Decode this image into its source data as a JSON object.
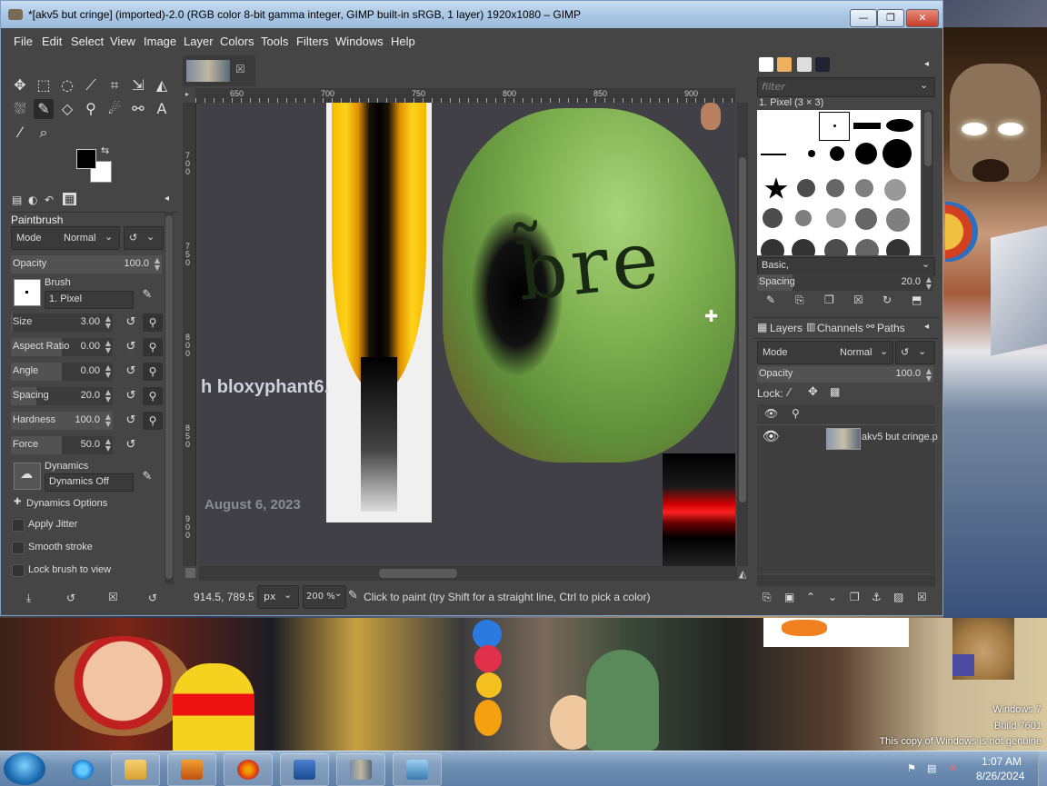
{
  "window": {
    "title": "*[akv5 but cringe] (imported)-2.0 (RGB color 8-bit gamma integer, GIMP built-in sRGB, 1 layer) 1920x1080 – GIMP",
    "min": "—",
    "max": "❐",
    "close": "✕"
  },
  "menu": [
    "File",
    "Edit",
    "Select",
    "View",
    "Image",
    "Layer",
    "Colors",
    "Tools",
    "Filters",
    "Windows",
    "Help"
  ],
  "tool_options": {
    "title": "Paintbrush",
    "mode_label": "Mode",
    "mode_value": "Normal",
    "opacity": {
      "label": "Opacity",
      "value": "100.0",
      "fraction": 1.0
    },
    "brush_label": "Brush",
    "brush_value": "1. Pixel",
    "size": {
      "label": "Size",
      "value": "3.00",
      "fraction": 0.02
    },
    "aspect": {
      "label": "Aspect Ratio",
      "value": "0.00",
      "fraction": 0.5
    },
    "angle": {
      "label": "Angle",
      "value": "0.00",
      "fraction": 0.5
    },
    "spacing": {
      "label": "Spacing",
      "value": "20.0",
      "fraction": 0.25
    },
    "hardness": {
      "label": "Hardness",
      "value": "100.0",
      "fraction": 1.0
    },
    "force": {
      "label": "Force",
      "value": "50.0",
      "fraction": 0.5
    },
    "dynamics_label": "Dynamics",
    "dynamics_value": "Dynamics Off",
    "dynamics_options": "Dynamics Options",
    "apply_jitter": "Apply Jitter",
    "smooth_stroke": "Smooth stroke",
    "lock_brush": "Lock brush to view"
  },
  "canvas": {
    "ruler_h": [
      "650",
      "700",
      "750",
      "800",
      "850",
      "900"
    ],
    "ruler_v": [
      "7\n0\n0",
      "7\n5\n0",
      "8\n0\n0",
      "8\n5\n0",
      "9\n0\n0"
    ],
    "watermark": "h bloxyphant6.",
    "date_text": "August 6, 2023",
    "drawn_text": "b̃re"
  },
  "status": {
    "coords": "914.5, 789.5",
    "unit": "px",
    "zoom": "200 %",
    "message": "Click to paint (try Shift for a straight line, Ctrl to pick a color)"
  },
  "brushes": {
    "filter_placeholder": "filter",
    "selected": "1. Pixel (3 × 3)",
    "tag": "Basic,",
    "spacing_label": "Spacing",
    "spacing_value": "20.0",
    "spacing_fraction": 0.2
  },
  "layers": {
    "tabs": [
      "Layers",
      "Channels",
      "Paths"
    ],
    "mode_label": "Mode",
    "mode_value": "Normal",
    "opacity_label": "Opacity",
    "opacity_value": "100.0",
    "lock_label": "Lock:",
    "layer_name": "akv5 but cringe.p"
  },
  "desktop": {
    "watermark1": "Windows 7",
    "watermark2": "Build 7601",
    "watermark3": "This copy of Windows is not genuine"
  },
  "taskbar": {
    "time": "1:07 AM",
    "date": "8/26/2024"
  }
}
